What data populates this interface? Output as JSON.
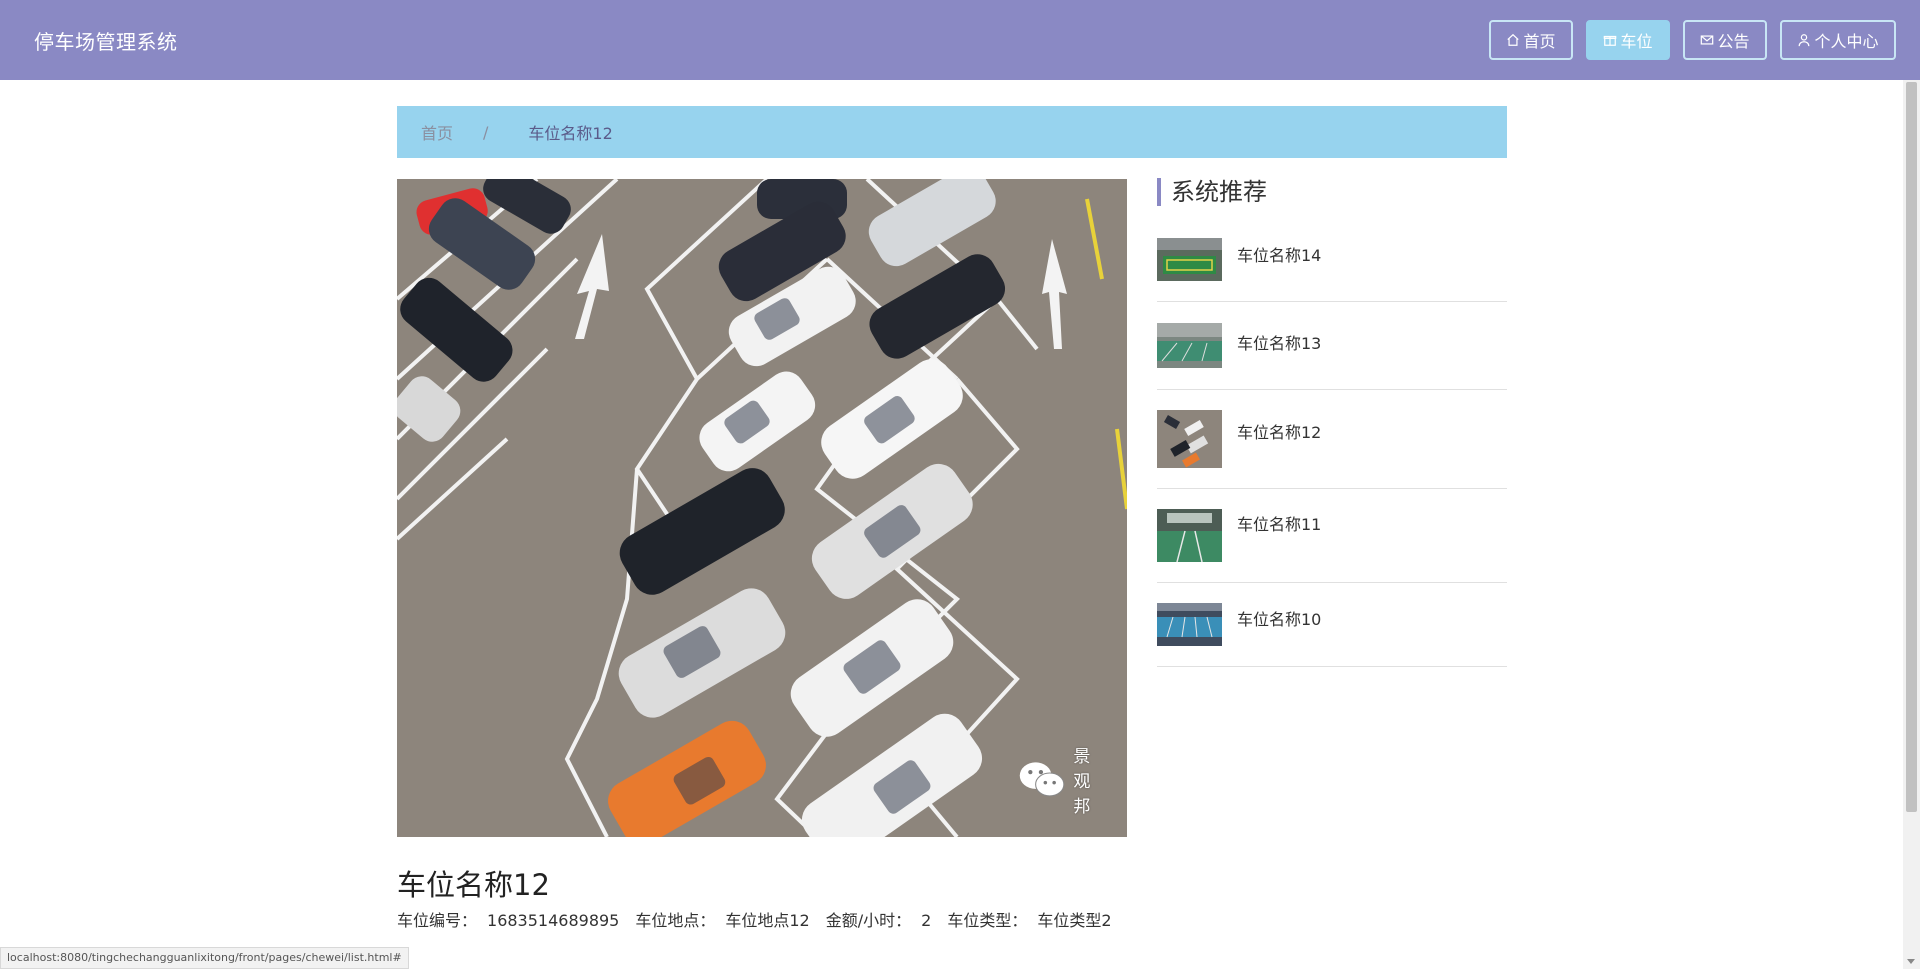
{
  "header": {
    "brand": "停车场管理系统",
    "nav": [
      {
        "label": "首页",
        "icon": "home-icon",
        "active": false
      },
      {
        "label": "车位",
        "icon": "gift-icon",
        "active": true
      },
      {
        "label": "公告",
        "icon": "mail-icon",
        "active": false
      },
      {
        "label": "个人中心",
        "icon": "user-icon",
        "active": false
      }
    ]
  },
  "breadcrumb": {
    "home": "首页",
    "separator": "/",
    "current": "车位名称12"
  },
  "detail": {
    "image_watermark": "景观邦",
    "title": "车位名称12",
    "info": [
      {
        "label": "车位编号：",
        "value": "1683514689895"
      },
      {
        "label": "车位地点：",
        "value": "车位地点12"
      },
      {
        "label": "金额/小时：",
        "value": "2"
      },
      {
        "label": "车位类型：",
        "value": "车位类型2"
      }
    ]
  },
  "sidebar": {
    "title": "系统推荐",
    "items": [
      {
        "label": "车位名称14"
      },
      {
        "label": "车位名称13"
      },
      {
        "label": "车位名称12"
      },
      {
        "label": "车位名称11"
      },
      {
        "label": "车位名称10"
      }
    ]
  },
  "statusbar": {
    "url": "localhost:8080/tingchechangguanlixitong/front/pages/chewei/list.html#"
  },
  "colors": {
    "header_bg": "#8a89c4",
    "accent_blue": "#97d3ee"
  }
}
